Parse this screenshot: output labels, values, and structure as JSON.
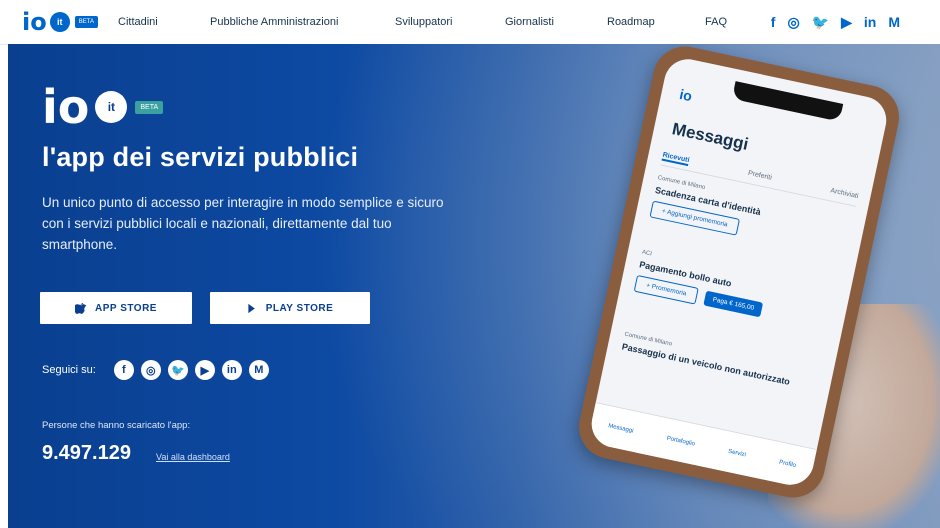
{
  "brand": {
    "logo_text": "io",
    "logo_badge": "it",
    "beta": "BETA"
  },
  "topnav": {
    "items": [
      "Cittadini",
      "Pubbliche Amministrazioni",
      "Sviluppatori",
      "Giornalisti",
      "Roadmap",
      "FAQ"
    ],
    "social": [
      "f",
      "◎",
      "🐦",
      "▶",
      "in",
      "M"
    ]
  },
  "hero": {
    "title": "l'app dei servizi pubblici",
    "subtitle": "Un unico punto di accesso per interagire in modo semplice e sicuro con i servizi pubblici locali e nazionali, direttamente dal tuo smartphone.",
    "app_store": "APP STORE",
    "play_store": "PLAY STORE",
    "follow_label": "Seguici su:",
    "follow_icons": [
      "f",
      "◎",
      "🐦",
      "▶",
      "in",
      "M"
    ],
    "downloads_label": "Persone che hanno scaricato l'app:",
    "downloads_count": "9.497.129",
    "dashboard_link": "Vai alla dashboard"
  },
  "phone": {
    "app_logo": "io",
    "screen_title": "Messaggi",
    "tabs": [
      "Ricevuti",
      "Preferiti",
      "Archiviati"
    ],
    "messages": [
      {
        "sender": "Comune di Milano",
        "subject": "Scadenza carta d'identità",
        "action": "+ Aggiungi promemoria"
      },
      {
        "sender": "ACI",
        "subject": "Pagamento bollo auto",
        "action": "+ Promemoria",
        "pay": "Paga € 165,00"
      },
      {
        "sender": "Comune di Milano",
        "subject": "Passaggio di un veicolo non autorizzato"
      }
    ],
    "bottom_nav": [
      "Messaggi",
      "Portafoglio",
      "Servizi",
      "Profilo"
    ]
  }
}
